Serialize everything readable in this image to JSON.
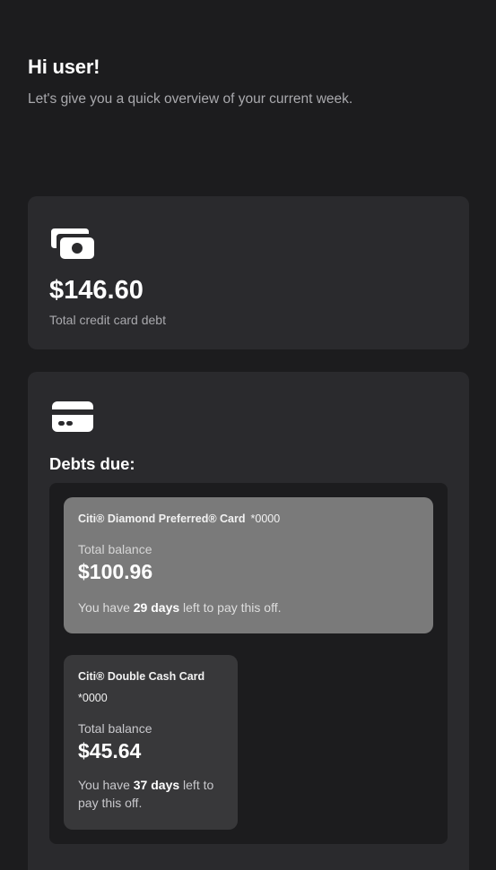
{
  "header": {
    "greeting": "Hi user!",
    "subtitle": "Let's give you a quick overview of your current week."
  },
  "summary_card": {
    "icon": "cash-icon",
    "amount": "$146.60",
    "caption": "Total credit card debt"
  },
  "debts_card": {
    "icon": "credit-card-icon",
    "heading": "Debts due:",
    "accounts": [
      {
        "name": "Citi® Diamond Preferred® Card",
        "mask": "*0000",
        "balance_label": "Total balance",
        "balance": "$100.96",
        "note_prefix": "You have",
        "days": "29 days",
        "note_suffix": "left to pay this off.",
        "color": "#7a7a7a"
      },
      {
        "name": "Citi® Double Cash Card",
        "mask": "*0000",
        "balance_label": "Total balance",
        "balance": "$45.64",
        "note_prefix": "You have",
        "days": "37 days",
        "note_suffix": "left to pay this off.",
        "color": "#38383a"
      }
    ]
  }
}
